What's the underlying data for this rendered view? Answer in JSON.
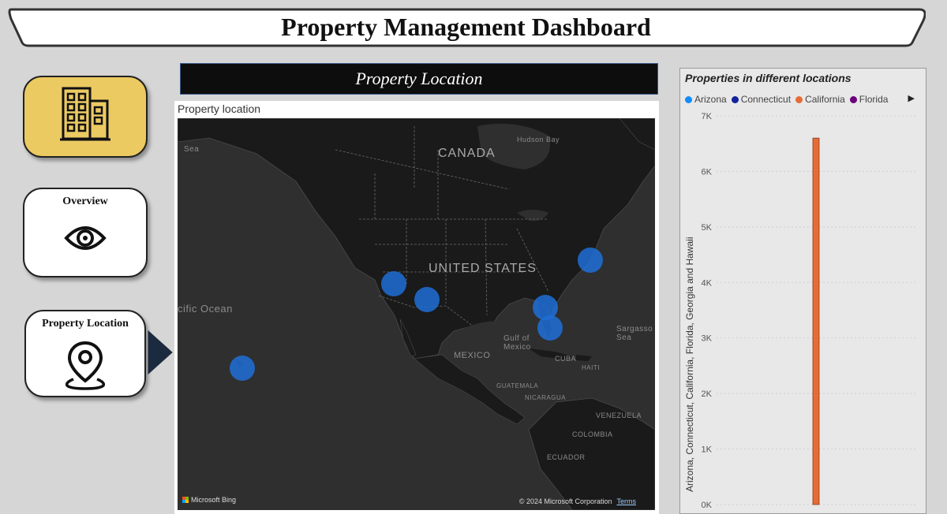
{
  "header": {
    "title": "Property Management Dashboard"
  },
  "nav": {
    "home": {
      "icon": "building-icon"
    },
    "overview": {
      "label": "Overview",
      "icon": "eye-icon"
    },
    "location": {
      "label": "Property Location",
      "icon": "map-pin-icon"
    }
  },
  "section": {
    "title": "Property Location"
  },
  "map": {
    "caption": "Property location",
    "labels": {
      "canada": "CANADA",
      "us": "UNITED STATES",
      "mexico": "MEXICO",
      "gulf": "Gulf of\nMexico",
      "pacific": "cific Ocean",
      "hudson": "Hudson Bay",
      "sea": "Sea",
      "sargasso": "Sargasso\nSea",
      "cuba": "CUBA",
      "haiti": "HAITI",
      "guatemala": "GUATEMALA",
      "nicaragua": "NICARAGUA",
      "venezuela": "VENEZUELA",
      "colombia": "COLOMBIA",
      "ecuador": "ECUADOR"
    },
    "attribution": {
      "left": "Microsoft Bing",
      "right": "© 2024 Microsoft Corporation",
      "terms": "Terms"
    },
    "bubble_color": "#1e6ed7"
  },
  "chart_data": {
    "type": "bar",
    "title": "Properties in different locations",
    "legend": [
      {
        "name": "Arizona",
        "color": "#118dff"
      },
      {
        "name": "Connecticut",
        "color": "#12239e"
      },
      {
        "name": "California",
        "color": "#e66c37"
      },
      {
        "name": "Florida",
        "color": "#6b007b"
      }
    ],
    "ylabel": "Arizona, Connecticut, California, Florida, Georgia and Hawaii",
    "yticks": [
      "0K",
      "1K",
      "2K",
      "3K",
      "4K",
      "5K",
      "6K",
      "7K"
    ],
    "ylim": [
      0,
      7000
    ],
    "grid": true,
    "series": [
      {
        "name": "California",
        "value": 6600,
        "color": "#e66c37"
      }
    ]
  }
}
